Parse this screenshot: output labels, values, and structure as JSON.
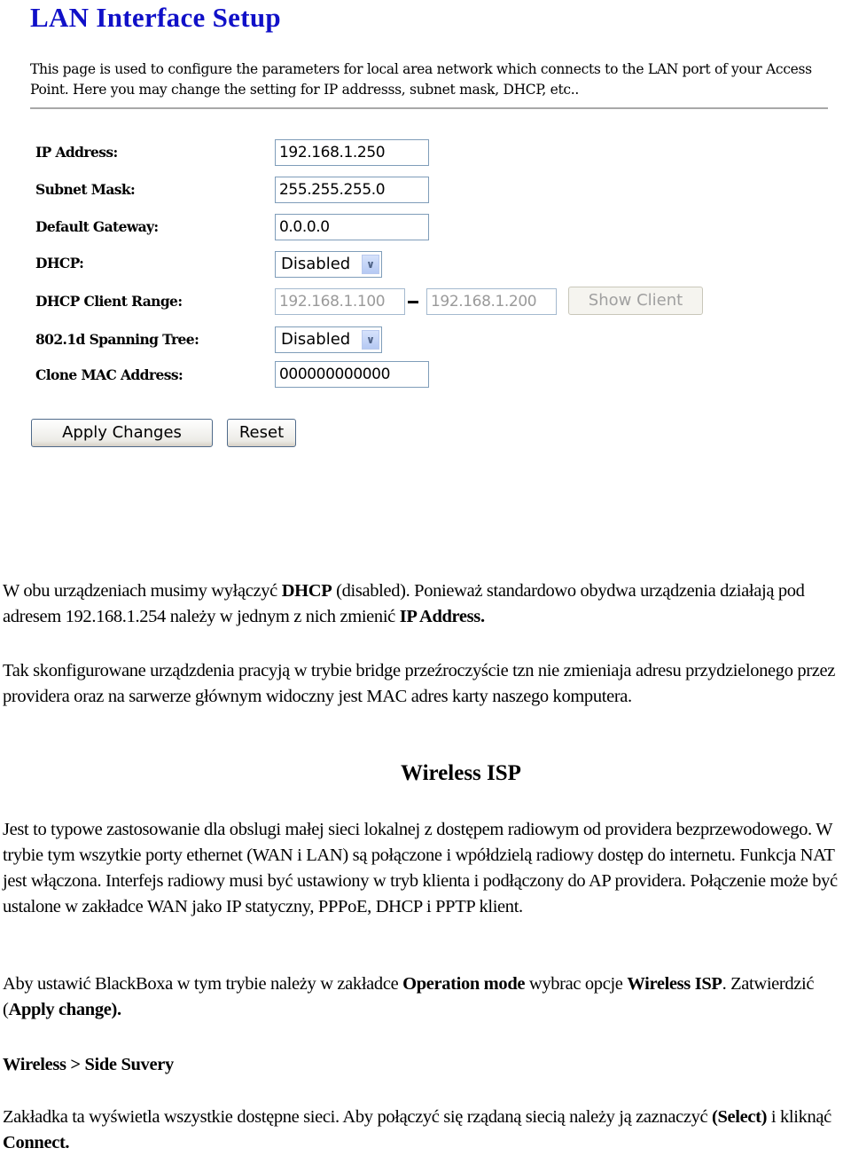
{
  "screenshot": {
    "title": "LAN Interface Setup",
    "description": "This page is used to configure the parameters for local area network which connects to the LAN port of your Access Point. Here you may change the setting for IP addresss, subnet mask, DHCP, etc..",
    "fields": {
      "ip_address": {
        "label": "IP Address:",
        "value": "192.168.1.250"
      },
      "subnet_mask": {
        "label": "Subnet Mask:",
        "value": "255.255.255.0"
      },
      "default_gateway": {
        "label": "Default Gateway:",
        "value": "0.0.0.0"
      },
      "dhcp": {
        "label": "DHCP:",
        "value": "Disabled"
      },
      "dhcp_client_range": {
        "label": "DHCP Client Range:",
        "start": "192.168.1.100",
        "separator": "-",
        "end": "192.168.1.200",
        "button": "Show Client"
      },
      "spanning_tree": {
        "label": "802.1d Spanning Tree:",
        "value": "Disabled"
      },
      "clone_mac": {
        "label": "Clone MAC Address:",
        "value": "000000000000"
      }
    },
    "buttons": {
      "apply": "Apply Changes",
      "reset": "Reset"
    }
  },
  "document": {
    "p1": {
      "t1": "W obu urządzeniach musimy wyłączyć ",
      "b1": "DHCP",
      "t2": " (disabled). Ponieważ standardowo obydwa urządzenia działają pod adresem 192.168.1.254 należy w jednym z nich zmienić ",
      "b2": "IP Address."
    },
    "p2": "Tak skonfigurowane urządzdenia pracyją w trybie bridge przeźroczyście tzn nie zmieniaja adresu przydzielonego przez providera oraz na sarwerze głównym widoczny jest MAC adres karty naszego komputera.",
    "heading": "Wireless ISP",
    "p3": "Jest to typowe zastosowanie dla obslugi małej sieci lokalnej z dostępem radiowym od providera bezprzewodowego. W trybie tym wszytkie porty ethernet (WAN i LAN) są połączone i wpółdzielą radiowy dostęp do internetu. Funkcja NAT jest włączona. Interfejs radiowy musi być ustawiony w tryb klienta i podłączony do AP providera. Połączenie może być ustalone w zakładce WAN jako IP statyczny, PPPoE, DHCP i PPTP klient.",
    "p4": {
      "t1": "Aby ustawić BlackBoxa w tym trybie należy w zakładce ",
      "b1": "Operation mode",
      "t2": " wybrac opcje ",
      "b2": "Wireless ISP",
      "t3": ". Zatwierdzić (",
      "b3": "Apply change).",
      "t4": ""
    },
    "p5": "Wireless > Side Suvery",
    "p6": {
      "t1": "Zakładka ta wyświetla wszystkie dostępne sieci. Aby połączyć się rządaną siecią należy ją zaznaczyć ",
      "b1": "(Select)",
      "t2": " i kliknąć ",
      "b2": "Connect."
    }
  }
}
